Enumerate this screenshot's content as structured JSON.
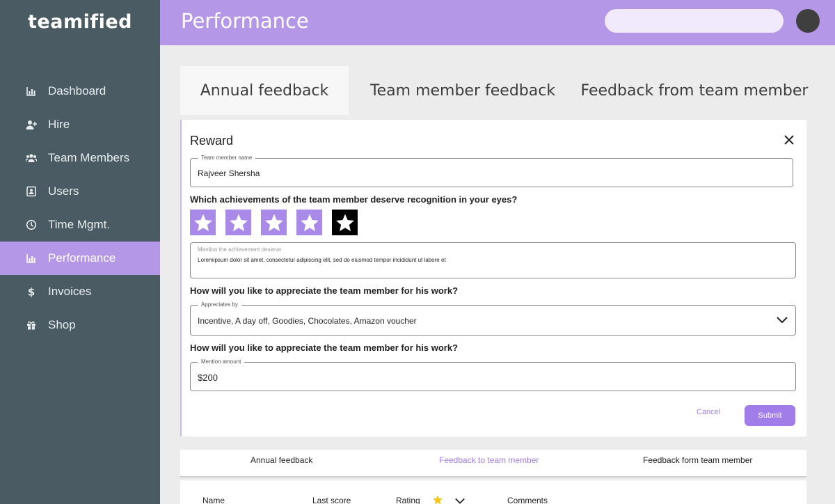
{
  "app": {
    "logo": "teamified"
  },
  "sidebar": {
    "items": [
      {
        "label": "Dashboard",
        "icon": "bar-chart-icon"
      },
      {
        "label": "Hire",
        "icon": "add-user-icon"
      },
      {
        "label": "Team Members",
        "icon": "users-icon"
      },
      {
        "label": "Users",
        "icon": "id-card-icon"
      },
      {
        "label": "Time Mgmt.",
        "icon": "clock-icon"
      },
      {
        "label": "Performance",
        "icon": "bar-chart-icon",
        "active": true
      },
      {
        "label": "Invoices",
        "icon": "dollar-icon"
      },
      {
        "label": "Shop",
        "icon": "gift-icon"
      }
    ]
  },
  "header": {
    "title": "Performance",
    "search_placeholder": ""
  },
  "tabs": [
    "Annual feedback",
    "Team member feedback",
    "Feedback from team member"
  ],
  "form": {
    "title": "Reward",
    "name_label": "Team member name",
    "name_value": "Rajveer Shersha",
    "q1": "Which achievements of the team member deserve recognition in your eyes?",
    "rating": {
      "value": 4,
      "max": 5
    },
    "achievement_label": "Mention the achievement deserve",
    "achievement_value": "Loremipsum dolor sit amet, consectetur adipiscing elit, sed do eiusmod tempor incididunt ut labore et",
    "q2": "How will you like to appreciate the team member for his work?",
    "appreciates_label": "Appreciates by",
    "appreciates_value": "Incentive, A day off, Goodies, Chocolates, Amazon voucher",
    "q3": "How will you like to appreciate the team member for his work?",
    "amount_label": "Mention amount",
    "amount_value": "$200",
    "cancel": "Cancel",
    "submit": "Submit"
  },
  "subtabs": [
    "Annual feedback",
    "Feedback to team member",
    "Feedback form team member"
  ],
  "table": {
    "headers": [
      "Name",
      "Last score",
      "Rating",
      "Comments"
    ]
  },
  "colors": {
    "sidebar": "#4b5b63",
    "accent": "#b497e7",
    "button": "#a07de8"
  }
}
